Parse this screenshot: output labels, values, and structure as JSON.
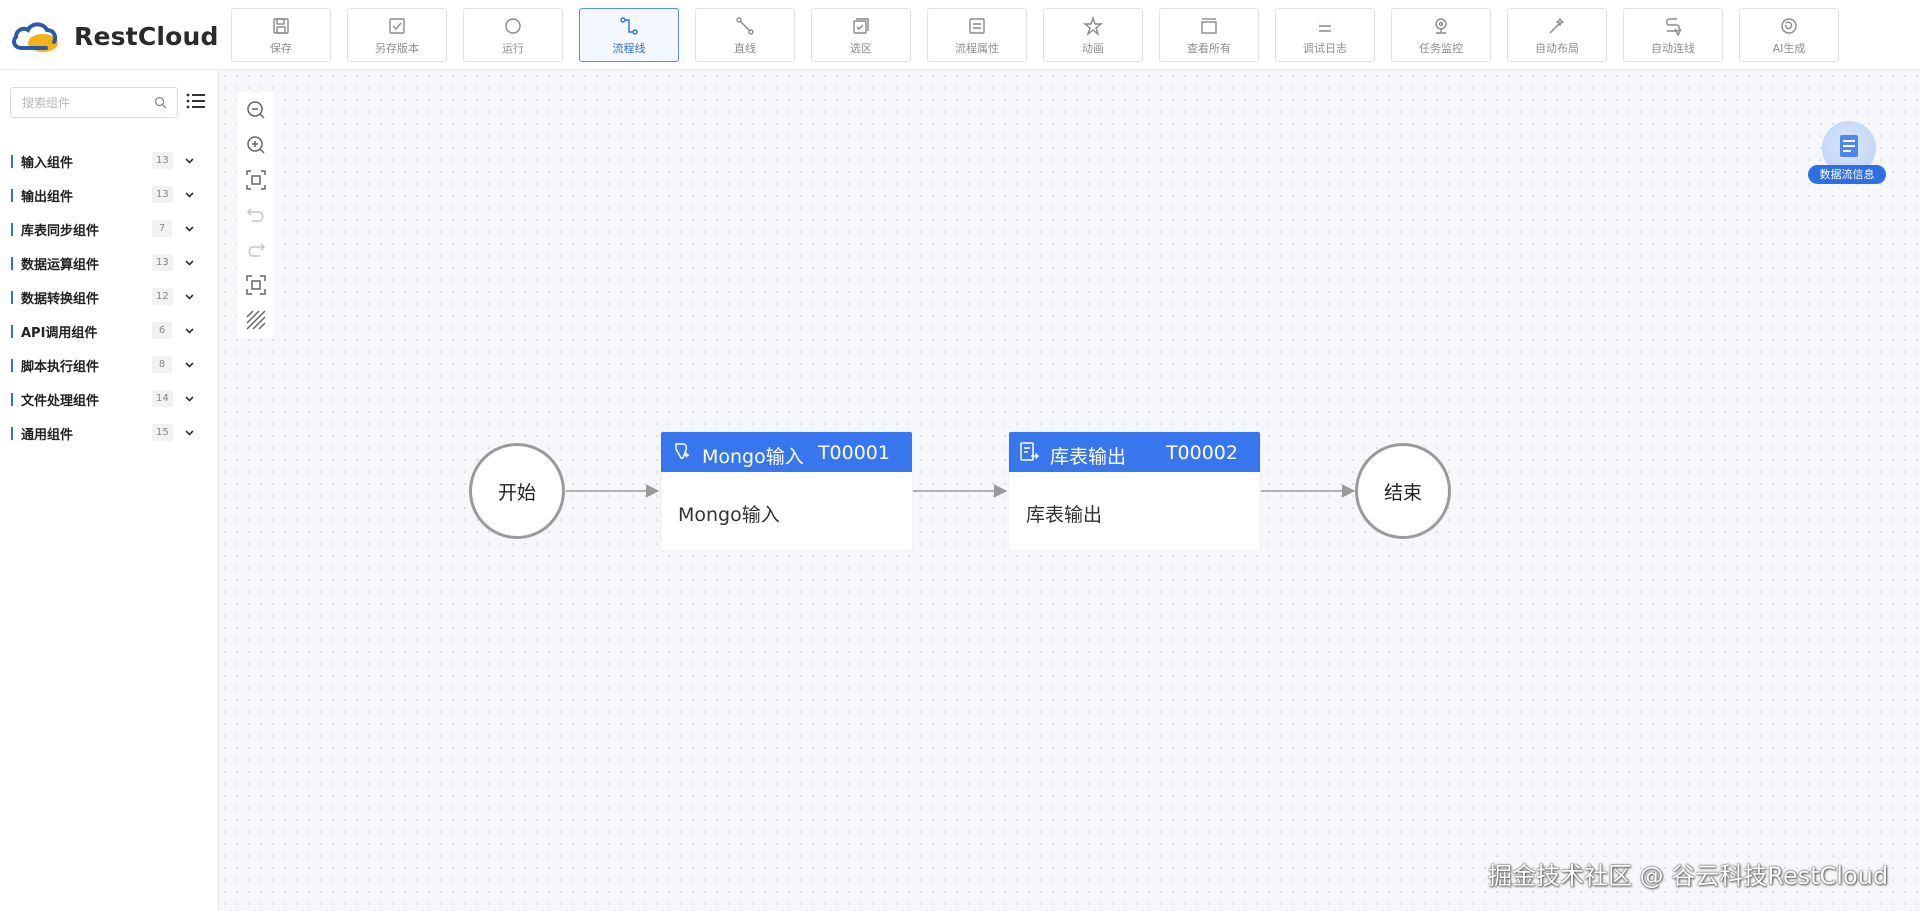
{
  "app": {
    "logo_text": "RestCloud"
  },
  "toolbar": [
    {
      "label": "保存",
      "icon": "save-icon",
      "active": false
    },
    {
      "label": "另存版本",
      "icon": "save-version-icon",
      "active": false
    },
    {
      "label": "运行",
      "icon": "run-icon",
      "active": false
    },
    {
      "label": "流程线",
      "icon": "flow-line-icon",
      "active": true
    },
    {
      "label": "直线",
      "icon": "straight-line-icon",
      "active": false
    },
    {
      "label": "选区",
      "icon": "select-area-icon",
      "active": false
    },
    {
      "label": "流程属性",
      "icon": "flow-properties-icon",
      "active": false
    },
    {
      "label": "动画",
      "icon": "animation-icon",
      "active": false
    },
    {
      "label": "查看所有",
      "icon": "view-all-icon",
      "active": false
    },
    {
      "label": "调试日志",
      "icon": "debug-log-icon",
      "active": false
    },
    {
      "label": "任务监控",
      "icon": "task-monitor-icon",
      "active": false
    },
    {
      "label": "自动布局",
      "icon": "auto-layout-icon",
      "active": false
    },
    {
      "label": "自动连线",
      "icon": "auto-connect-icon",
      "active": false
    },
    {
      "label": "AI生成",
      "icon": "ai-generate-icon",
      "active": false
    }
  ],
  "sidebar": {
    "search_placeholder": "搜索组件",
    "categories": [
      {
        "label": "输入组件",
        "count": "13"
      },
      {
        "label": "输出组件",
        "count": "13"
      },
      {
        "label": "库表同步组件",
        "count": "7"
      },
      {
        "label": "数据运算组件",
        "count": "13"
      },
      {
        "label": "数据转换组件",
        "count": "12"
      },
      {
        "label": "API调用组件",
        "count": "6"
      },
      {
        "label": "脚本执行组件",
        "count": "8"
      },
      {
        "label": "文件处理组件",
        "count": "14"
      },
      {
        "label": "通用组件",
        "count": "15"
      }
    ]
  },
  "canvas": {
    "zoom_tools": [
      "zoom-out-icon",
      "zoom-in-icon",
      "fit-view-icon",
      "undo-icon",
      "redo-icon",
      "fullscreen-icon",
      "grid-toggle-icon"
    ],
    "flow_info_label": "数据流信息",
    "start_label": "开始",
    "end_label": "结束",
    "nodes": [
      {
        "title": "Mongo输入",
        "code": "T00001",
        "body": "Mongo输入",
        "icon": "mongo-input-icon"
      },
      {
        "title": "库表输出",
        "code": "T00002",
        "body": "库表输出",
        "icon": "table-output-icon"
      }
    ],
    "accent_color": "#3776ec"
  },
  "watermark": "掘金技术社区 @ 谷云科技RestCloud"
}
